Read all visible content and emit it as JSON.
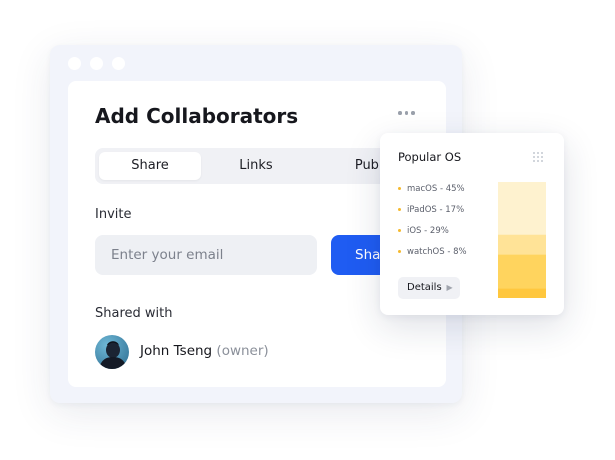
{
  "main_card": {
    "title": "Add Collaborators",
    "tabs": [
      {
        "label": "Share",
        "active": true
      },
      {
        "label": "Links",
        "active": false
      },
      {
        "label": "Publish",
        "active": false
      }
    ],
    "invite_label": "Invite",
    "email_placeholder": "Enter your email",
    "share_button": "Share",
    "shared_with_label": "Shared with",
    "collaborators": [
      {
        "name": "John Tseng",
        "role": "(owner)"
      }
    ]
  },
  "popular_os": {
    "title": "Popular OS",
    "details_button": "Details",
    "chart_data": {
      "type": "bar",
      "title": "Popular OS",
      "series": [
        {
          "name": "macOS",
          "value": 45,
          "label": "macOS - 45%",
          "color": "#fef2cf"
        },
        {
          "name": "iPadOS",
          "value": 17,
          "label": "iPadOS - 17%",
          "color": "#ffe397"
        },
        {
          "name": "iOS",
          "value": 29,
          "label": "iOS - 29%",
          "color": "#ffd45e"
        },
        {
          "name": "watchOS",
          "value": 8,
          "label": "watchOS - 8%",
          "color": "#ffc73e"
        }
      ],
      "bullet_color": "#f5b92e"
    }
  },
  "colors": {
    "accent": "#1f5cf2",
    "window_bg": "#f2f4fb"
  }
}
